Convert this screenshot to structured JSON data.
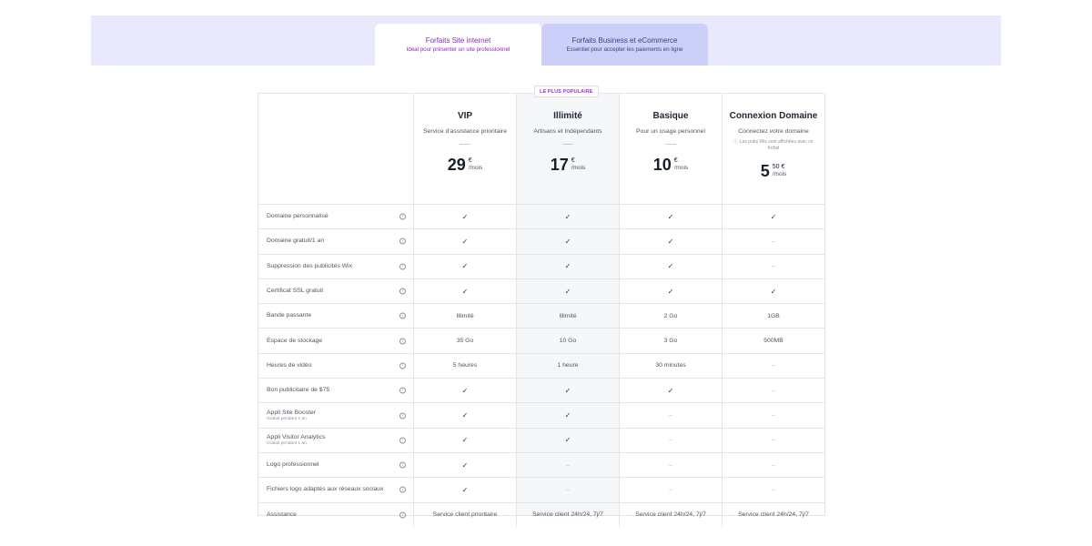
{
  "tabs": [
    {
      "title": "Forfaits Site internet",
      "subtitle": "Idéal pour présenter un site professionnel",
      "active": true
    },
    {
      "title": "Forfaits Business et eCommerce",
      "subtitle": "Essentiel pour accepter les paiements en ligne",
      "active": false
    }
  ],
  "badge": "LE PLUS POPULAIRE",
  "plans": [
    {
      "name": "VIP",
      "desc": "Service d'assistance prioritaire",
      "note": "",
      "price_int": "29",
      "price_dec": "",
      "currency": "€",
      "period": "/mois"
    },
    {
      "name": "Illimité",
      "desc": "Artisans et Indépendants",
      "note": "",
      "price_int": "17",
      "price_dec": "",
      "currency": "€",
      "period": "/mois"
    },
    {
      "name": "Basique",
      "desc": "Pour un usage personnel",
      "note": "",
      "price_int": "10",
      "price_dec": "",
      "currency": "€",
      "period": "/mois"
    },
    {
      "name": "Connexion Domaine",
      "desc": "Connectez votre domaine",
      "note": "Les pubs Wix sont affichées avec ce forfait",
      "price_int": "5",
      "price_dec": "50",
      "currency": "€",
      "period": "/mois"
    }
  ],
  "features": [
    {
      "label": "Domaine personnalisé",
      "sub": "",
      "values": [
        "check",
        "check",
        "check",
        "check"
      ]
    },
    {
      "label": "Domaine gratuit/1 an",
      "sub": "",
      "values": [
        "check",
        "check",
        "check",
        "dash"
      ]
    },
    {
      "label": "Suppression des publicités Wix",
      "sub": "",
      "values": [
        "check",
        "check",
        "check",
        "dash"
      ]
    },
    {
      "label": "Certificat SSL gratuit",
      "sub": "",
      "values": [
        "check",
        "check",
        "check",
        "check"
      ]
    },
    {
      "label": "Bande passante",
      "sub": "",
      "values": [
        "Illimité",
        "Illimité",
        "2 Go",
        "1GB"
      ]
    },
    {
      "label": "Espace de stockage",
      "sub": "",
      "values": [
        "35 Go",
        "10 Go",
        "3 Go",
        "500MB"
      ]
    },
    {
      "label": "Heures de vidéo",
      "sub": "",
      "values": [
        "5 heures",
        "1 heure",
        "30 minutes",
        "dash"
      ]
    },
    {
      "label": "Bon publicitaire de $75",
      "sub": "",
      "values": [
        "check",
        "check",
        "check",
        "dash"
      ]
    },
    {
      "label": "Appli Site Booster",
      "sub": "Gratuit pendant 1 an",
      "values": [
        "check",
        "check",
        "dash",
        "dash"
      ]
    },
    {
      "label": "Appli Visitor Analytics",
      "sub": "Gratuit pendant 1 an",
      "values": [
        "check",
        "check",
        "dash",
        "dash"
      ]
    },
    {
      "label": "Logo professionnel",
      "sub": "",
      "values": [
        "check",
        "dash",
        "dash",
        "dash"
      ]
    },
    {
      "label": "Fichiers logo adaptés aux réseaux sociaux",
      "sub": "",
      "values": [
        "check",
        "dash",
        "dash",
        "dash"
      ]
    },
    {
      "label": "Assistance",
      "sub": "",
      "values": [
        "Service client prioritaire",
        "Service client 24h/24, 7j/7",
        "Service client 24h/24, 7j/7",
        "Service client 24h/24, 7j/7"
      ]
    }
  ],
  "icons": {
    "check": "check-icon",
    "dash": "dash-icon",
    "info": "info-icon"
  },
  "colors": {
    "accent": "#8a2bc0",
    "band": "#e8e9fc",
    "inactive_tab": "#ccd0f8"
  }
}
